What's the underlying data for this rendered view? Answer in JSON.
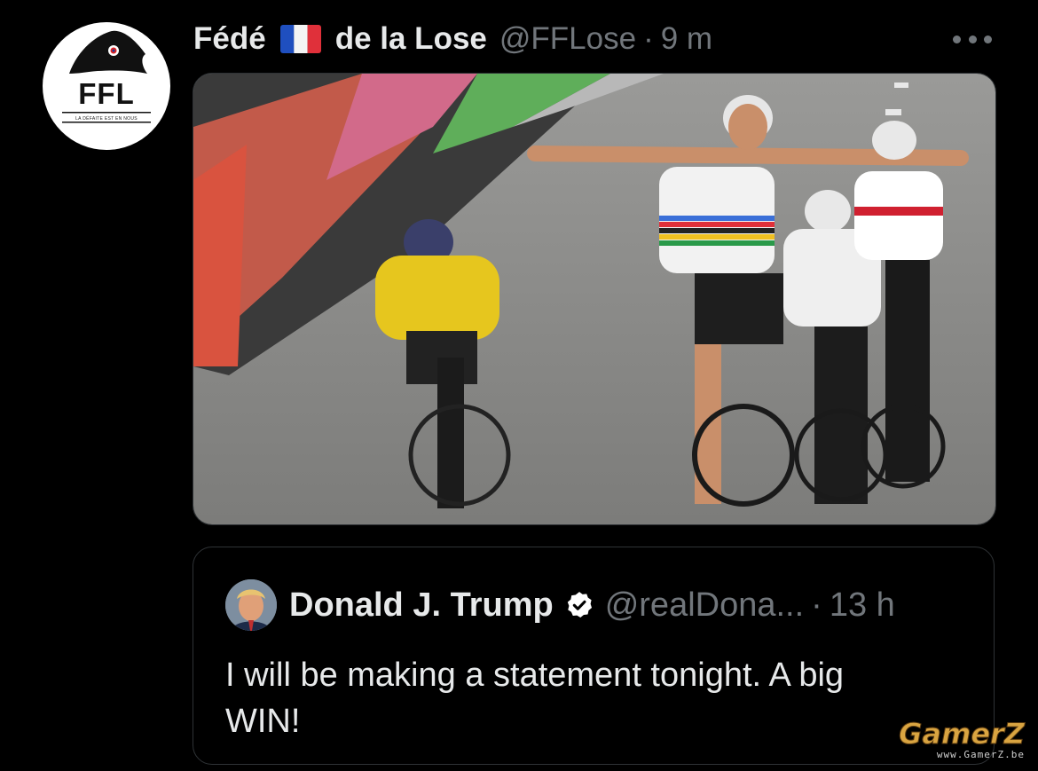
{
  "tweet": {
    "author_name_part1": "Fédé",
    "author_flag": "france-flag",
    "author_name_part2": "de la Lose",
    "handle": "@FFLose",
    "separator": "·",
    "time": "9 m",
    "avatar": {
      "abbr": "FFL",
      "motto": "LA DÉFAITE EST EN NOUS"
    }
  },
  "quote": {
    "author_name": "Donald J. Trump",
    "handle": "@realDona...",
    "separator": "·",
    "time": "13 h",
    "text_line1": "I will be making a statement tonight. A big",
    "text_line2": "WIN!"
  },
  "watermark": {
    "logo": "GamerZ",
    "url": "www.GamerZ.be"
  },
  "colors": {
    "background": "#000000",
    "primary_text": "#e7e9ea",
    "secondary_text": "#71767b",
    "border": "#2f3336"
  }
}
